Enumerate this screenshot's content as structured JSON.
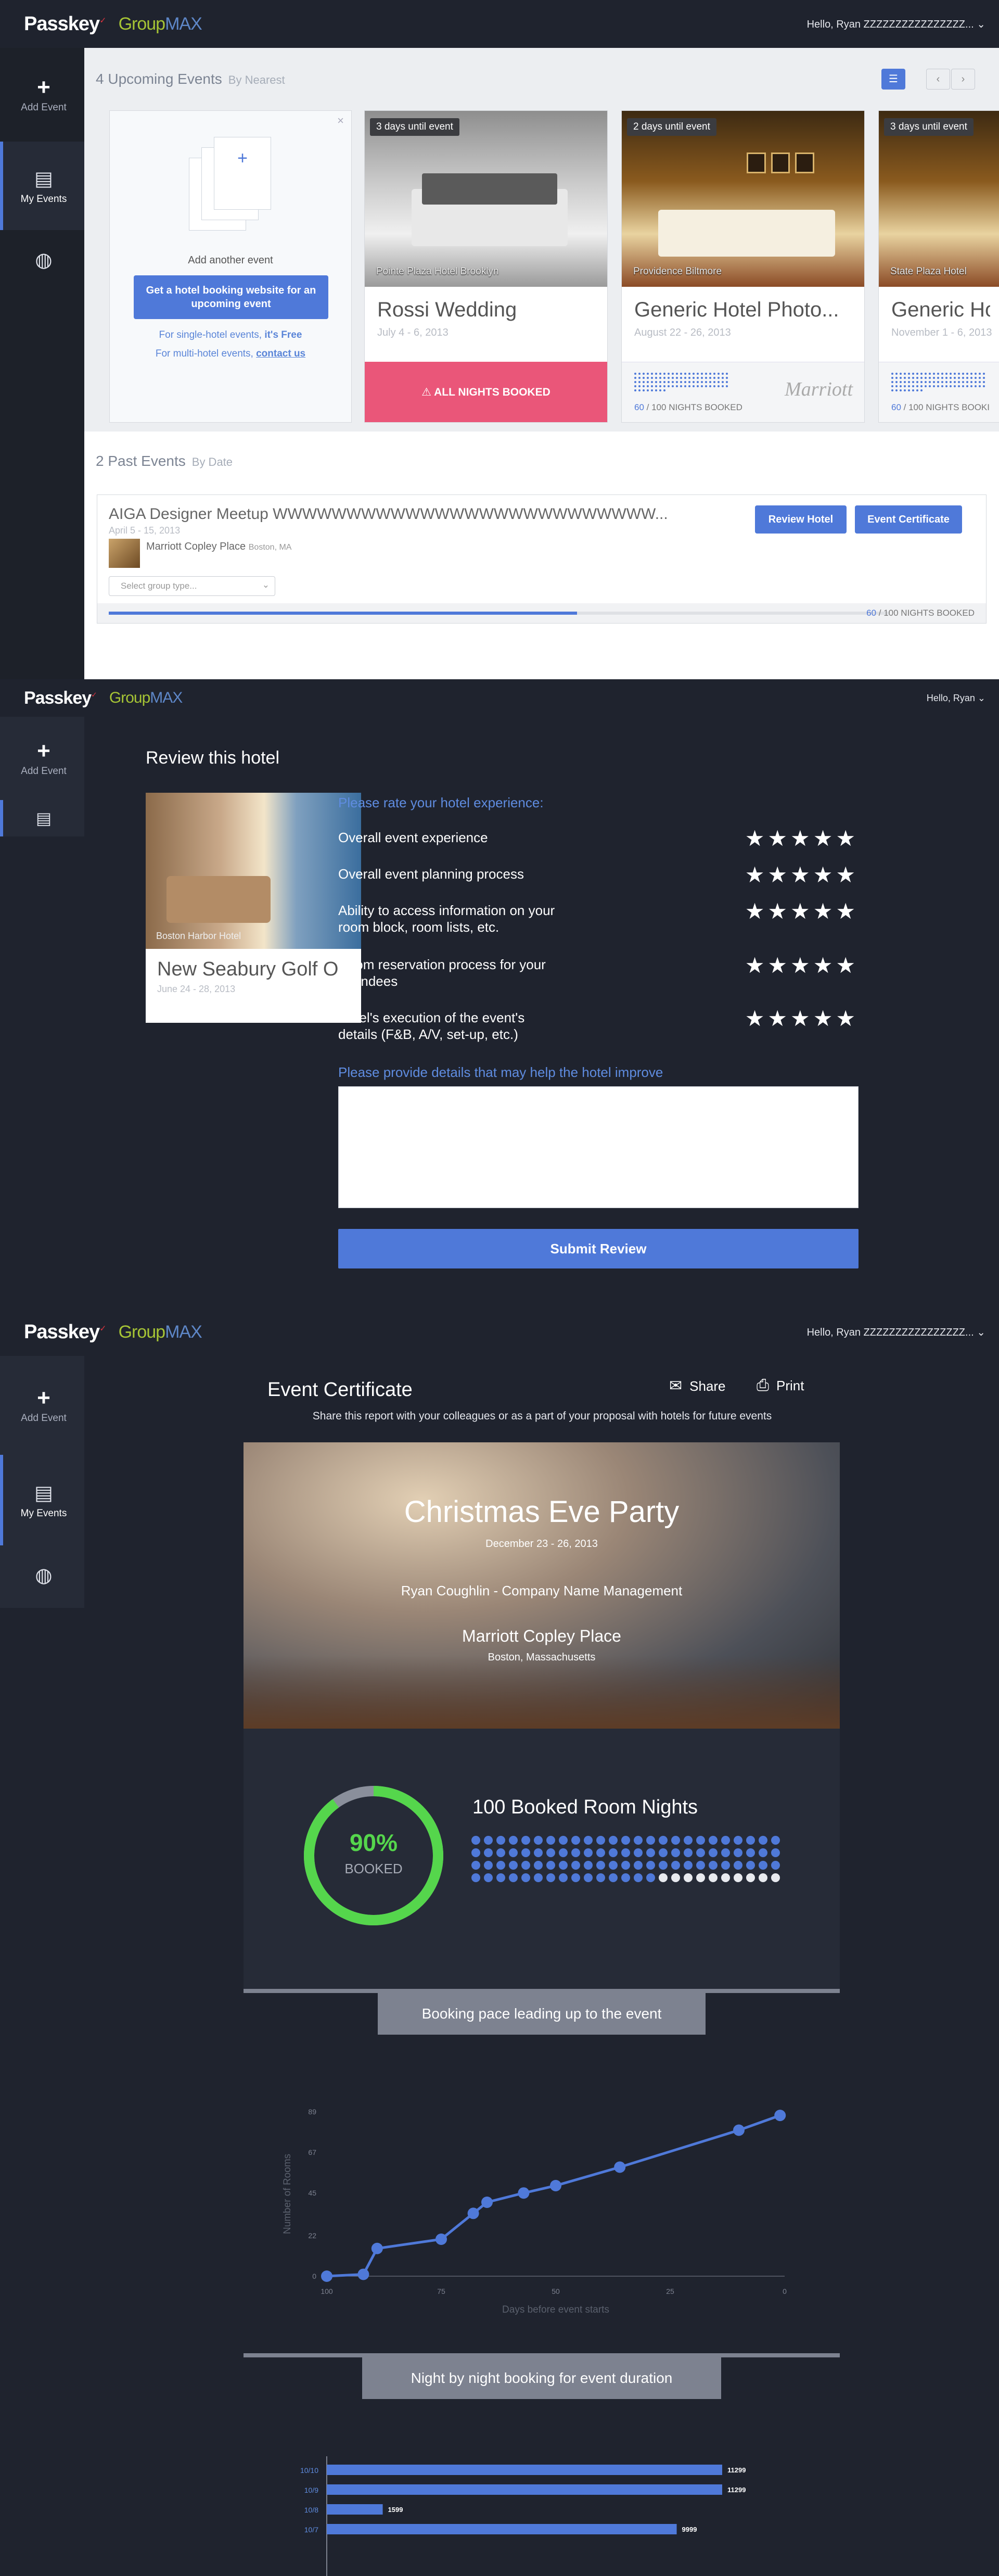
{
  "brand": {
    "logo": "Passkey",
    "group": "Group",
    "max": "MAX"
  },
  "s1": {
    "hello": "Hello, Ryan ZZZZZZZZZZZZZZZZ... ⌄",
    "nav": {
      "add": "Add Event",
      "my": "My Events"
    },
    "upcoming": {
      "title": "4 Upcoming Events",
      "sort": "By Nearest"
    },
    "add_card": {
      "title": "Add another event",
      "button": "Get a hotel booking website for an upcoming event",
      "single_prefix": "For single-hotel events,",
      "single_free": "it's Free",
      "multi_prefix": "For multi-hotel events,",
      "multi_link": "contact us"
    },
    "cards": [
      {
        "tag": "3 days until event",
        "hotel": "Pointe Plaza Hotel Brooklyn",
        "name": "Rossi Wedding",
        "dates": "July 4 - 6, 2013",
        "status": "⚠ ALL NIGHTS BOOKED"
      },
      {
        "tag": "2 days until event",
        "hotel": "Providence Biltmore",
        "name": "Generic Hotel Photo...",
        "dates": "August 22 - 26, 2013",
        "booked": "60",
        "total": "/ 100 NIGHTS BOOKED",
        "chain": "Marriott"
      },
      {
        "tag": "3 days until event",
        "hotel": "State Plaza Hotel",
        "name": "Generic Ho",
        "dates": "November 1 - 6, 2013",
        "booked": "60",
        "total": "/ 100 NIGHTS BOOKI"
      }
    ],
    "past": {
      "title": "2 Past Events",
      "sort": "By Date"
    },
    "past_event": {
      "name": "AIGA Designer Meetup WWWWWWWWWWWWWWWWWWWWWWWWWW...",
      "dates": "April 5 - 15, 2013",
      "hotel": "Marriott Copley Place",
      "city": "Boston, MA",
      "select": "Select group type...",
      "review": "Review Hotel",
      "certificate": "Event Certificate",
      "booked": "60",
      "total": "/ 100 NIGHTS BOOKED",
      "progress": 0.6
    }
  },
  "s2": {
    "hello": "Hello, Ryan ⌄",
    "nav": {
      "add": "Add Event"
    },
    "title": "Review this hotel",
    "hotel_caption": "Boston Harbor Hotel",
    "event_name": "New Seabury Golf O",
    "event_dates": "June 24 - 28, 2013",
    "prompt": "Please rate your hotel experience:",
    "questions": [
      "Overall event experience",
      "Overall event planning process",
      "Ability to access information on your room block, room lists, etc.",
      "Room reservation process for your attendees",
      "Hotel's execution of the event's details (F&B, A/V, set-up, etc.)"
    ],
    "stars": "★★★★★",
    "details_prompt": "Please provide details that may help the hotel improve",
    "submit": "Submit Review"
  },
  "s3": {
    "hello": "Hello, Ryan ZZZZZZZZZZZZZZZZ... ⌄",
    "nav": {
      "add": "Add Event",
      "my": "My Events"
    },
    "title": "Event Certificate",
    "share": "Share",
    "print": "Print",
    "subtitle": "Share this report with your colleagues or as a part of your proposal with hotels for future events",
    "event": "Christmas Eve Party",
    "dates": "December 23 - 26, 2013",
    "organizer": "Ryan Coughlin - Company Name Management",
    "hotel": "Marriott Copley Place",
    "city": "Boston, Massachusetts",
    "pct_text": "90%",
    "pct_value": 0.9,
    "booked_label": "BOOKED",
    "nights_title": "100 Booked Room Nights",
    "nights_booked": 90,
    "nights_total": 100,
    "pace_title": "Booking pace leading up to the event",
    "nbn_title": "Night by night booking for event duration"
  },
  "chart_data": [
    {
      "type": "line",
      "title": "Booking pace leading up to the event",
      "xlabel": "Days before event starts",
      "ylabel": "Number of Rooms",
      "xlim": [
        100,
        0
      ],
      "ylim": [
        0,
        89
      ],
      "xticks": [
        "100",
        "75",
        "50",
        "25",
        "0"
      ],
      "yticks": [
        "89",
        "67",
        "45",
        "22",
        "0"
      ],
      "series": [
        {
          "values": [
            [
              100,
              0
            ],
            [
              92,
              1
            ],
            [
              89,
              15
            ],
            [
              75,
              20
            ],
            [
              68,
              34
            ],
            [
              65,
              40
            ],
            [
              57,
              45
            ],
            [
              50,
              49
            ],
            [
              36,
              59
            ],
            [
              10,
              79
            ],
            [
              1,
              87
            ]
          ]
        }
      ]
    },
    {
      "type": "bar",
      "title": "Night by night booking for event duration",
      "categories": [
        "10/10",
        "10/9",
        "10/8",
        "10/7"
      ],
      "values": [
        11299,
        11299,
        1599,
        9999
      ],
      "labels": [
        "11299",
        "11299",
        "1599",
        "9999"
      ]
    }
  ]
}
